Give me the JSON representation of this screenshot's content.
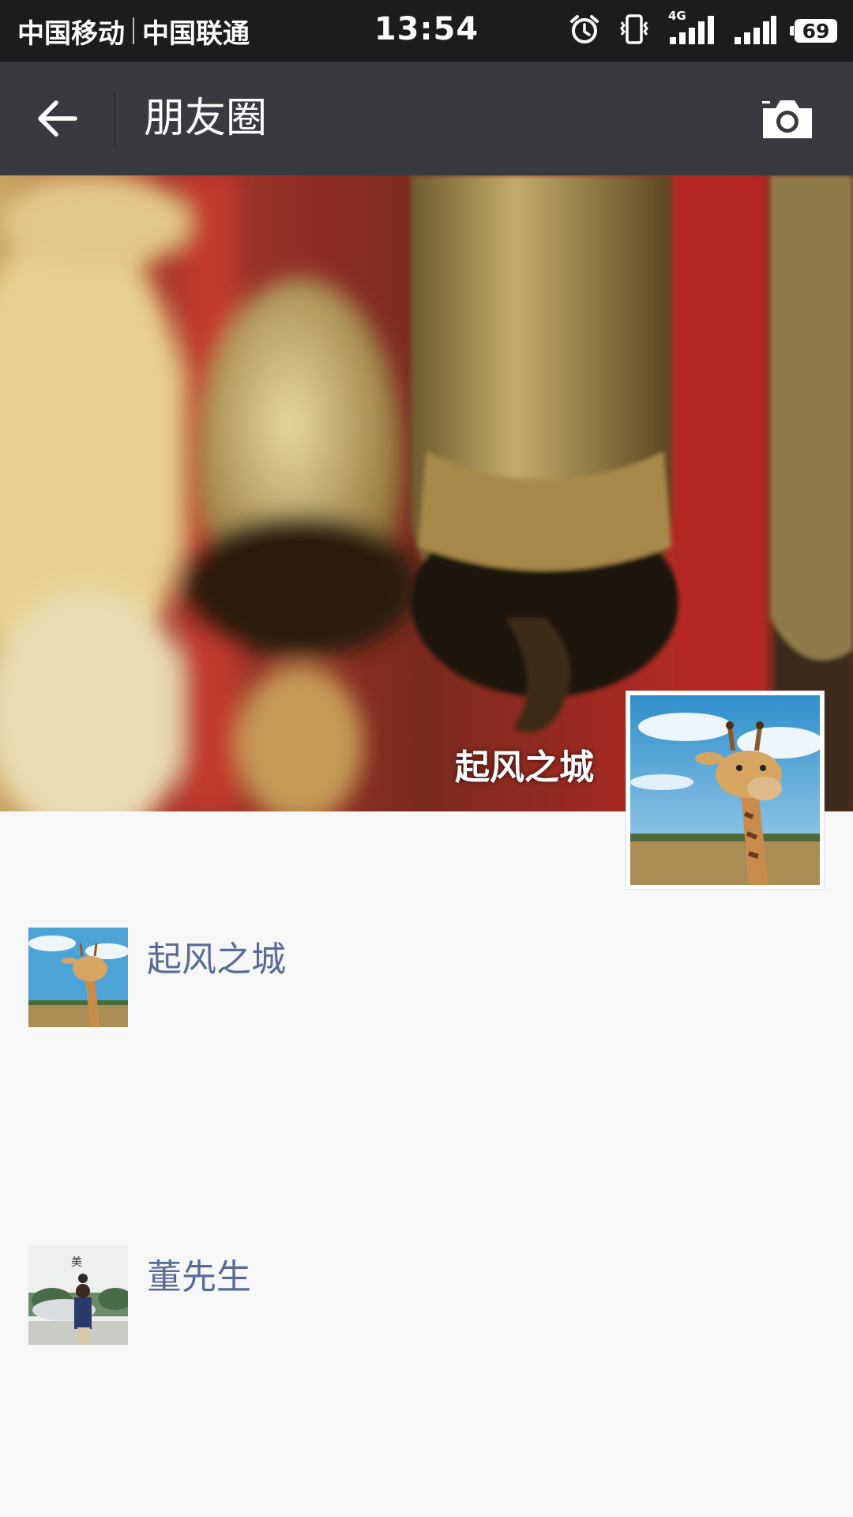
{
  "status_bar": {
    "carrier1": "中国移动",
    "carrier2": "中国联通",
    "time": "13:54",
    "network": "4G",
    "sim1_slot": "2",
    "sim2_slot": "1",
    "battery": "69",
    "icons": [
      "alarm-icon",
      "vibrate-icon",
      "signal-4g-icon",
      "signal-icon",
      "battery-icon"
    ]
  },
  "header": {
    "title": "朋友圈",
    "back_icon": "back-arrow-icon",
    "camera_icon": "camera-icon"
  },
  "cover": {
    "user_name": "起风之城"
  },
  "feed": [
    {
      "name": "起风之城",
      "avatar": "giraffe"
    },
    {
      "name": "董先生",
      "avatar": "person-at-fountain"
    }
  ],
  "colors": {
    "status_bar": "#1b1c1e",
    "title_bar": "#393a3f",
    "background": "#f7f7f7",
    "name_link": "#576b95"
  }
}
